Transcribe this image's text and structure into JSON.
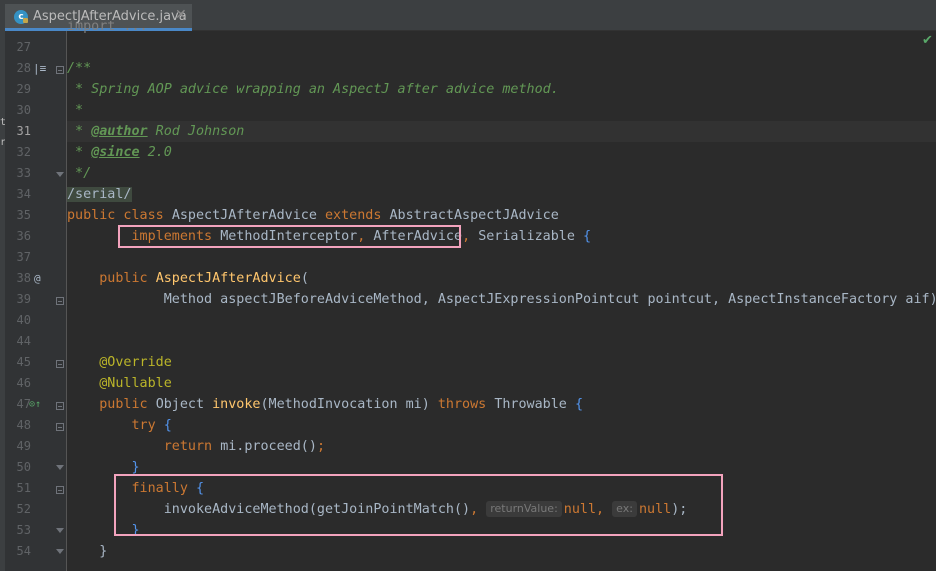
{
  "tab": {
    "title": "AspectJAfterAdvice.java",
    "icon": "java-class-icon",
    "icon_letter": "c",
    "close": "✕"
  },
  "editor": {
    "top_partial": "import ...",
    "inspection_status": "check-icon",
    "line_numbers": [
      "27",
      "28",
      "29",
      "30",
      "31",
      "32",
      "33",
      "34",
      "35",
      "36",
      "37",
      "38",
      "39",
      "40",
      "44",
      "45",
      "46",
      "47",
      "48",
      "49",
      "50",
      "51",
      "52",
      "53",
      "54"
    ],
    "current_line": "31",
    "code": {
      "l29": " * Spring AOP advice wrapping an AspectJ after advice method.",
      "l30": " *",
      "l31_pre": " * ",
      "l31_tag": "@author",
      "l31_post": " Rod Johnson",
      "l32_pre": " * ",
      "l32_tag": "@since",
      "l32_post": " 2.0",
      "l28": "/**",
      "l33": " */",
      "l34": "/serial/",
      "l35_kw1": "public class ",
      "l35_name": "AspectJAfterAdvice ",
      "l35_kw2": "extends ",
      "l35_super": "AbstractAspectJAdvice",
      "l36_indent": "        ",
      "l36_kw": "implements ",
      "l36_i1": "MethodInterceptor",
      "l36_comma1": ", ",
      "l36_i2": "AfterAdvice",
      "l36_comma2": ", ",
      "l36_i3": "Serializable ",
      "l36_brace": "{",
      "l38_indent": "    ",
      "l38_kw": "public ",
      "l38_ctor": "AspectJAfterAdvice",
      "l38_paren": "(",
      "l39": "            Method aspectJBeforeAdviceMethod, AspectJExpressionPointcut pointcut, AspectInstanceFactory aif)",
      "l45": "    @Override",
      "l46": "    @Nullable",
      "l47_indent": "    ",
      "l47_kw": "public ",
      "l47_type": "Object ",
      "l47_fn": "invoke",
      "l47_args": "(MethodInvocation mi) ",
      "l47_throws": "throws ",
      "l47_exc": "Throwable ",
      "l47_brace": "{",
      "l48_indent": "        ",
      "l48_kw": "try ",
      "l48_brace": "{",
      "l49_indent": "            ",
      "l49_kw": "return ",
      "l49_rest": "mi.proceed()",
      "l49_semi": ";",
      "l50_indent": "        ",
      "l50_brace": "}",
      "l51_indent": "        ",
      "l51_kw": "finally ",
      "l51_brace": "{",
      "l52_indent": "            ",
      "l52_call": "invokeAdviceMethod(getJoinPointMatch()",
      "l52_comma": ", ",
      "l52_hint1": "returnValue:",
      "l52_null1": "null",
      "l52_comma2": ", ",
      "l52_hint2": "ex:",
      "l52_null2": "null",
      "l52_end": ");",
      "l53_indent": "        ",
      "l53_brace": "}",
      "l54_indent": "    ",
      "l54_brace": "}"
    }
  },
  "colors": {
    "keyword": "#cc7832",
    "comment": "#629755",
    "annotation": "#bbb529",
    "method": "#ffc66d",
    "highlight_box": "#f3a3bd",
    "background": "#2b2b2b"
  }
}
